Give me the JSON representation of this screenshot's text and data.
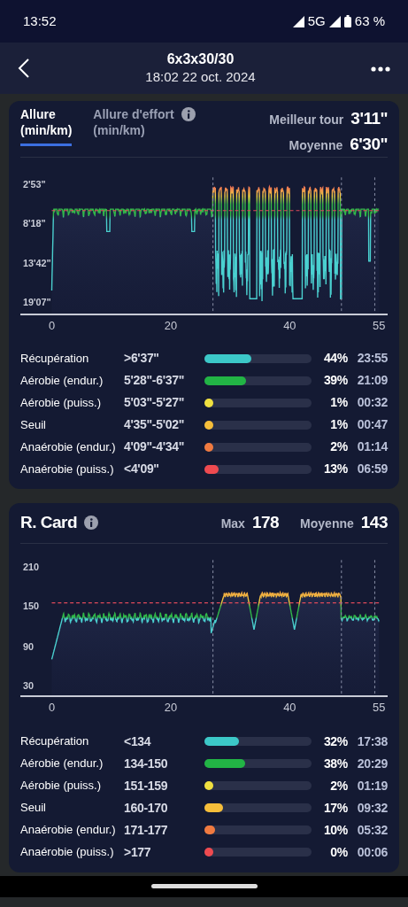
{
  "status_bar": {
    "time": "13:52",
    "network": "5G",
    "battery": "63 %"
  },
  "header": {
    "title": "6x3x30/30",
    "subtitle": "18:02 22 oct. 2024"
  },
  "pace_card": {
    "tabs": [
      {
        "label": "Allure",
        "unit": "(min/km)",
        "selected": true,
        "info": false
      },
      {
        "label": "Allure d'effort",
        "unit": "(min/km)",
        "selected": false,
        "info": true
      }
    ],
    "stats": [
      {
        "label": "Meilleur tour",
        "value": "3'11\""
      },
      {
        "label": "Moyenne",
        "value": "6'30\""
      }
    ],
    "y_axis_labels": [
      "2'53\"",
      "8'18\"",
      "13'42\"",
      "19'07\""
    ],
    "x_axis_labels": [
      "0",
      "20",
      "40",
      "55"
    ],
    "zones": [
      {
        "name": "Récupération",
        "range": ">6'37\"",
        "level": 0.44,
        "percent": "44%",
        "time": "23:55",
        "color": "#3cc8c8"
      },
      {
        "name": "Aérobie (endur.)",
        "range": "5'28\"-6'37\"",
        "level": 0.39,
        "percent": "39%",
        "time": "21:09",
        "color": "#22b445"
      },
      {
        "name": "Aérobie (puiss.)",
        "range": "5'03\"-5'27\"",
        "level": 0.01,
        "percent": "1%",
        "time": "00:32",
        "color": "#f0e040"
      },
      {
        "name": "Seuil",
        "range": "4'35\"-5'02\"",
        "level": 0.01,
        "percent": "1%",
        "time": "00:47",
        "color": "#f6be3a"
      },
      {
        "name": "Anaérobie (endur.)",
        "range": "4'09\"-4'34\"",
        "level": 0.02,
        "percent": "2%",
        "time": "01:14",
        "color": "#f07a40"
      },
      {
        "name": "Anaérobie (puiss.)",
        "range": "<4'09\"",
        "level": 0.13,
        "percent": "13%",
        "time": "06:59",
        "color": "#ee4a50"
      }
    ]
  },
  "hr_card": {
    "title": "R. Card",
    "info": true,
    "stats": [
      {
        "label": "Max",
        "value": "178"
      },
      {
        "label": "Moyenne",
        "value": "143"
      }
    ],
    "y_axis_labels": [
      "210",
      "150",
      "90",
      "30"
    ],
    "x_axis_labels": [
      "0",
      "20",
      "40",
      "55"
    ],
    "zones": [
      {
        "name": "Récupération",
        "range": "<134",
        "level": 0.32,
        "percent": "32%",
        "time": "17:38",
        "color": "#3cc8c8"
      },
      {
        "name": "Aérobie (endur.)",
        "range": "134-150",
        "level": 0.38,
        "percent": "38%",
        "time": "20:29",
        "color": "#22b445"
      },
      {
        "name": "Aérobie (puiss.)",
        "range": "151-159",
        "level": 0.02,
        "percent": "2%",
        "time": "01:19",
        "color": "#f0e040"
      },
      {
        "name": "Seuil",
        "range": "160-170",
        "level": 0.17,
        "percent": "17%",
        "time": "09:32",
        "color": "#f6be3a"
      },
      {
        "name": "Anaérobie (endur.)",
        "range": "171-177",
        "level": 0.1,
        "percent": "10%",
        "time": "05:32",
        "color": "#f07a40"
      },
      {
        "name": "Anaérobie (puiss.)",
        "range": ">177",
        "level": 0.0,
        "percent": "0%",
        "time": "00:06",
        "color": "#ee4a50"
      }
    ]
  }
}
